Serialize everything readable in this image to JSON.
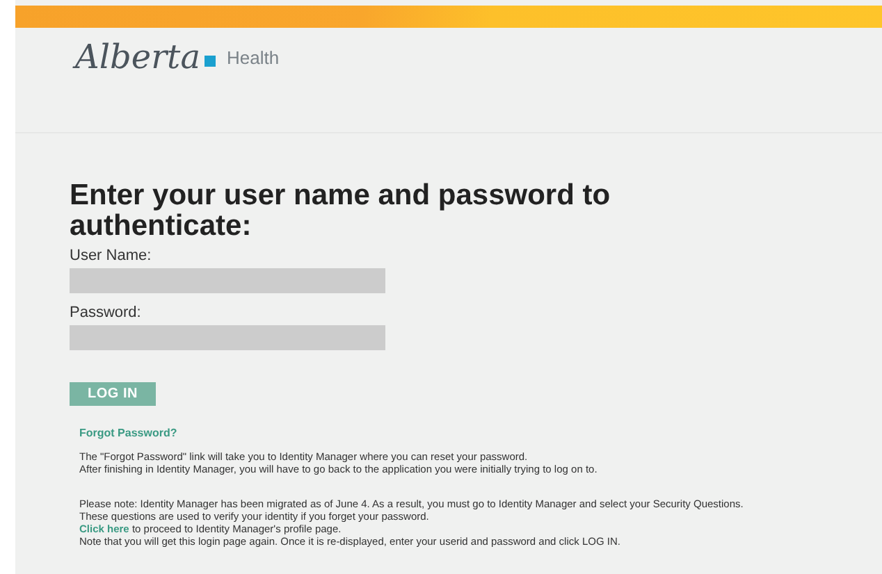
{
  "header": {
    "logo_script": "Alberta",
    "logo_word": "Health"
  },
  "heading": "Enter your user name and password to authenticate:",
  "fields": [
    {
      "label": "User Name:"
    },
    {
      "label": "Password:"
    }
  ],
  "login_button": "LOG IN",
  "forgot_link": "Forgot Password?",
  "forgot_info": [
    "The \"Forgot Password\" link will take you to Identity Manager where you can reset your password.",
    "After finishing in Identity Manager, you will have to go back to the application you were initially trying to log on to."
  ],
  "note_lines": [
    {
      "text": "Please note: Identity Manager has been migrated as of June 4. As a result, you must go to Identity Manager and select your Security Questions."
    },
    {
      "text": "These questions are used to verify your identity if you forget your password."
    },
    {
      "link": "Click here",
      "text": " to proceed to Identity Manager's profile page."
    },
    {
      "text": "Note that you will get this login page again. Once it is re-displayed, enter your userid and password and click LOG IN."
    }
  ]
}
